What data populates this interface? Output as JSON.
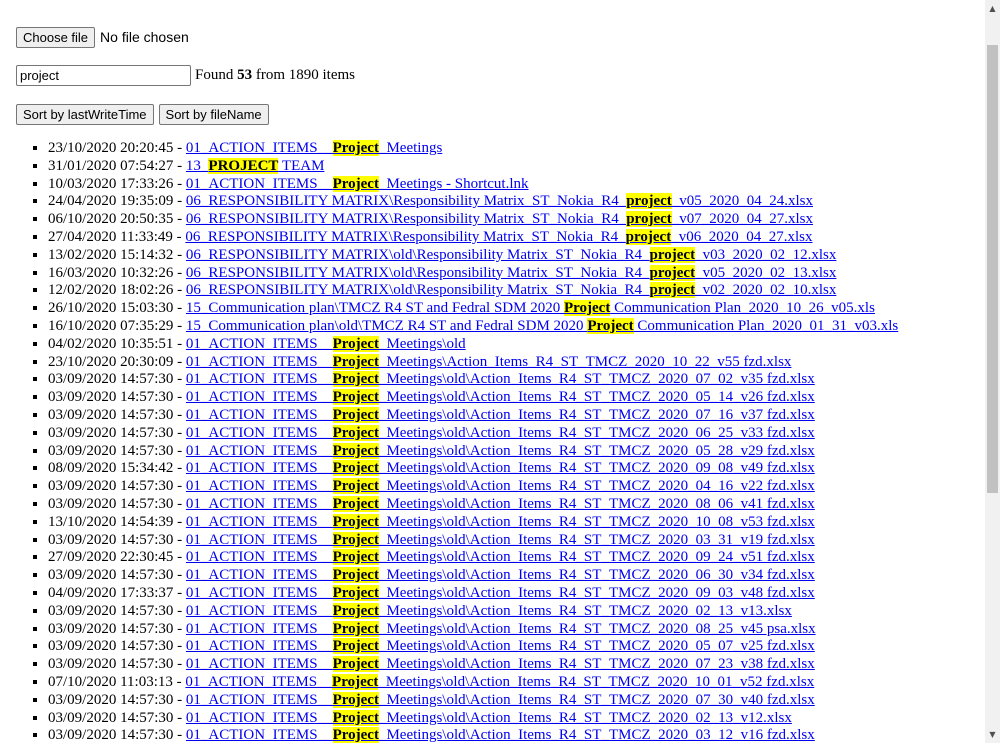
{
  "file_picker": {
    "button_label": "Choose file",
    "status": "No file chosen"
  },
  "search": {
    "value": "project",
    "found_prefix": "Found",
    "found_count": "53",
    "found_suffix": "from 1890 items"
  },
  "sort": {
    "by_time_label": "Sort by lastWriteTime",
    "by_name_label": "Sort by fileName"
  },
  "results": [
    {
      "date": "23/10/2020 20:20:45",
      "pre": "01_ACTION_ITEMS__",
      "match": "Project",
      "post": "_Meetings"
    },
    {
      "date": "31/01/2020 07:54:27",
      "pre": "13_",
      "match": "PROJECT",
      "post": " TEAM"
    },
    {
      "date": "10/03/2020 17:33:26",
      "pre": "01_ACTION_ITEMS__",
      "match": "Project",
      "post": "_Meetings - Shortcut.lnk"
    },
    {
      "date": "24/04/2020 19:35:09",
      "pre": "06_RESPONSIBILITY MATRIX\\Responsibility Matrix_ST_Nokia_R4_",
      "match": "project",
      "post": "_v05_2020_04_24.xlsx"
    },
    {
      "date": "06/10/2020 20:50:35",
      "pre": "06_RESPONSIBILITY MATRIX\\Responsibility Matrix_ST_Nokia_R4_",
      "match": "project",
      "post": "_v07_2020_04_27.xlsx"
    },
    {
      "date": "27/04/2020 11:33:49",
      "pre": "06_RESPONSIBILITY MATRIX\\Responsibility Matrix_ST_Nokia_R4_",
      "match": "project",
      "post": "_v06_2020_04_27.xlsx"
    },
    {
      "date": "13/02/2020 15:14:32",
      "pre": "06_RESPONSIBILITY MATRIX\\old\\Responsibility Matrix_ST_Nokia_R4_",
      "match": "project",
      "post": "_v03_2020_02_12.xlsx"
    },
    {
      "date": "16/03/2020 10:32:26",
      "pre": "06_RESPONSIBILITY MATRIX\\old\\Responsibility Matrix_ST_Nokia_R4_",
      "match": "project",
      "post": "_v05_2020_02_13.xlsx"
    },
    {
      "date": "12/02/2020 18:02:26",
      "pre": "06_RESPONSIBILITY MATRIX\\old\\Responsibility Matrix_ST_Nokia_R4_",
      "match": "project",
      "post": "_v02_2020_02_10.xlsx"
    },
    {
      "date": "26/10/2020 15:03:30",
      "pre": "15_Communication plan\\TMCZ R4 ST and Fedral SDM 2020 ",
      "match": "Project",
      "post": " Communication Plan_2020_10_26_v05.xls"
    },
    {
      "date": "16/10/2020 07:35:29",
      "pre": "15_Communication plan\\old\\TMCZ R4 ST and Fedral SDM 2020 ",
      "match": "Project",
      "post": " Communication Plan_2020_01_31_v03.xls"
    },
    {
      "date": "04/02/2020 10:35:51",
      "pre": "01_ACTION_ITEMS__",
      "match": "Project",
      "post": "_Meetings\\old"
    },
    {
      "date": "23/10/2020 20:30:09",
      "pre": "01_ACTION_ITEMS__",
      "match": "Project",
      "post": "_Meetings\\Action_Items_R4_ST_TMCZ_2020_10_22_v55 fzd.xlsx"
    },
    {
      "date": "03/09/2020 14:57:30",
      "pre": "01_ACTION_ITEMS__",
      "match": "Project",
      "post": "_Meetings\\old\\Action_Items_R4_ST_TMCZ_2020_07_02_v35 fzd.xlsx"
    },
    {
      "date": "03/09/2020 14:57:30",
      "pre": "01_ACTION_ITEMS__",
      "match": "Project",
      "post": "_Meetings\\old\\Action_Items_R4_ST_TMCZ_2020_05_14_v26 fzd.xlsx"
    },
    {
      "date": "03/09/2020 14:57:30",
      "pre": "01_ACTION_ITEMS__",
      "match": "Project",
      "post": "_Meetings\\old\\Action_Items_R4_ST_TMCZ_2020_07_16_v37 fzd.xlsx"
    },
    {
      "date": "03/09/2020 14:57:30",
      "pre": "01_ACTION_ITEMS__",
      "match": "Project",
      "post": "_Meetings\\old\\Action_Items_R4_ST_TMCZ_2020_06_25_v33 fzd.xlsx"
    },
    {
      "date": "03/09/2020 14:57:30",
      "pre": "01_ACTION_ITEMS__",
      "match": "Project",
      "post": "_Meetings\\old\\Action_Items_R4_ST_TMCZ_2020_05_28_v29 fzd.xlsx"
    },
    {
      "date": "08/09/2020 15:34:42",
      "pre": "01_ACTION_ITEMS__",
      "match": "Project",
      "post": "_Meetings\\old\\Action_Items_R4_ST_TMCZ_2020_09_08_v49 fzd.xlsx"
    },
    {
      "date": "03/09/2020 14:57:30",
      "pre": "01_ACTION_ITEMS__",
      "match": "Project",
      "post": "_Meetings\\old\\Action_Items_R4_ST_TMCZ_2020_04_16_v22 fzd.xlsx"
    },
    {
      "date": "03/09/2020 14:57:30",
      "pre": "01_ACTION_ITEMS__",
      "match": "Project",
      "post": "_Meetings\\old\\Action_Items_R4_ST_TMCZ_2020_08_06_v41 fzd.xlsx"
    },
    {
      "date": "13/10/2020 14:54:39",
      "pre": "01_ACTION_ITEMS__",
      "match": "Project",
      "post": "_Meetings\\old\\Action_Items_R4_ST_TMCZ_2020_10_08_v53 fzd.xlsx"
    },
    {
      "date": "03/09/2020 14:57:30",
      "pre": "01_ACTION_ITEMS__",
      "match": "Project",
      "post": "_Meetings\\old\\Action_Items_R4_ST_TMCZ_2020_03_31_v19 fzd.xlsx"
    },
    {
      "date": "27/09/2020 22:30:45",
      "pre": "01_ACTION_ITEMS__",
      "match": "Project",
      "post": "_Meetings\\old\\Action_Items_R4_ST_TMCZ_2020_09_24_v51 fzd.xlsx"
    },
    {
      "date": "03/09/2020 14:57:30",
      "pre": "01_ACTION_ITEMS__",
      "match": "Project",
      "post": "_Meetings\\old\\Action_Items_R4_ST_TMCZ_2020_06_30_v34 fzd.xlsx"
    },
    {
      "date": "04/09/2020 17:33:37",
      "pre": "01_ACTION_ITEMS__",
      "match": "Project",
      "post": "_Meetings\\old\\Action_Items_R4_ST_TMCZ_2020_09_03_v48 fzd.xlsx"
    },
    {
      "date": "03/09/2020 14:57:30",
      "pre": "01_ACTION_ITEMS__",
      "match": "Project",
      "post": "_Meetings\\old\\Action_Items_R4_ST_TMCZ_2020_02_13_v13.xlsx"
    },
    {
      "date": "03/09/2020 14:57:30",
      "pre": "01_ACTION_ITEMS__",
      "match": "Project",
      "post": "_Meetings\\old\\Action_Items_R4_ST_TMCZ_2020_08_25_v45 psa.xlsx"
    },
    {
      "date": "03/09/2020 14:57:30",
      "pre": "01_ACTION_ITEMS__",
      "match": "Project",
      "post": "_Meetings\\old\\Action_Items_R4_ST_TMCZ_2020_05_07_v25 fzd.xlsx"
    },
    {
      "date": "03/09/2020 14:57:30",
      "pre": "01_ACTION_ITEMS__",
      "match": "Project",
      "post": "_Meetings\\old\\Action_Items_R4_ST_TMCZ_2020_07_23_v38 fzd.xlsx"
    },
    {
      "date": "07/10/2020 11:03:13",
      "pre": "01_ACTION_ITEMS__",
      "match": "Project",
      "post": "_Meetings\\old\\Action_Items_R4_ST_TMCZ_2020_10_01_v52 fzd.xlsx"
    },
    {
      "date": "03/09/2020 14:57:30",
      "pre": "01_ACTION_ITEMS__",
      "match": "Project",
      "post": "_Meetings\\old\\Action_Items_R4_ST_TMCZ_2020_07_30_v40 fzd.xlsx"
    },
    {
      "date": "03/09/2020 14:57:30",
      "pre": "01_ACTION_ITEMS__",
      "match": "Project",
      "post": "_Meetings\\old\\Action_Items_R4_ST_TMCZ_2020_02_13_v12.xlsx"
    },
    {
      "date": "03/09/2020 14:57:30",
      "pre": "01_ACTION_ITEMS__",
      "match": "Project",
      "post": "_Meetings\\old\\Action_Items_R4_ST_TMCZ_2020_03_12_v16 fzd.xlsx"
    }
  ],
  "date_separator": " - ",
  "icons": {
    "scroll_up": "▲",
    "scroll_down": "▼"
  }
}
